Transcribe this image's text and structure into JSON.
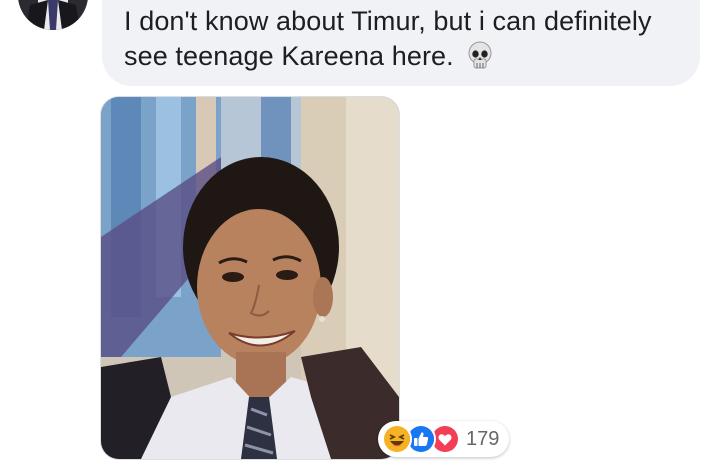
{
  "comment": {
    "text": "I don't know about Timur, but i can definitely see teenage Kareena here.",
    "emoji_icon": "skull-icon"
  },
  "reactions": {
    "icons": [
      "haha-icon",
      "like-icon",
      "love-icon"
    ],
    "count": "179"
  },
  "colors": {
    "bubble_background": "#f0f2f5",
    "text": "#1c1e21",
    "like_blue": "#1877f2",
    "love_red": "#f33e58",
    "haha_yellow": "#f7b125",
    "count_gray": "#65676b"
  }
}
